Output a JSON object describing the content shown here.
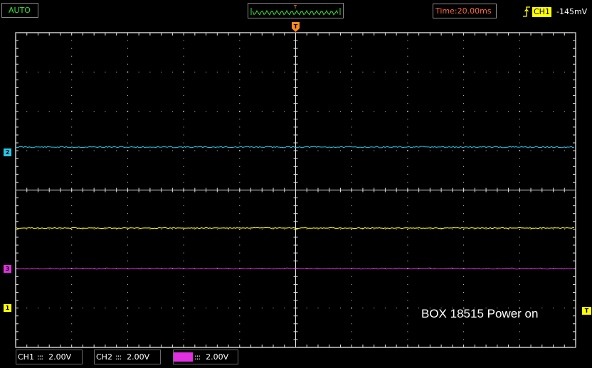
{
  "header": {
    "mode": "AUTO",
    "time": "Time:20.00ms",
    "trigger_channel": "CH1",
    "trigger_level": "-145mV",
    "mem_marker": "T"
  },
  "markers": {
    "ch2": "2",
    "ch3": "3",
    "ch1": "1",
    "top_trigger": "T",
    "right_trigger": "T"
  },
  "caption": "BOX 18515 Power on",
  "footer": {
    "ch1": {
      "name": "CH1",
      "coupling": ":::",
      "scale": "2.00V"
    },
    "ch2": {
      "name": "CH2",
      "coupling": ":::",
      "scale": "2.00V"
    },
    "ch3": {
      "name": "CH3",
      "coupling": ":::",
      "scale": "2.00V"
    }
  },
  "colors": {
    "ch1": "#ffff00",
    "ch2": "#24c8e8",
    "ch3": "#e030e0",
    "grid": "#e6e6e6",
    "mode": "#35e335",
    "time": "#ff6b3d",
    "trigger": "#ff8c1a"
  }
}
